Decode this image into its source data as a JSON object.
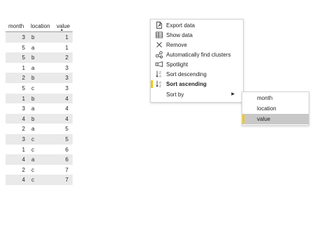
{
  "table": {
    "columns": [
      "month",
      "location",
      "value"
    ],
    "sort_indicator": "▲",
    "rows": [
      {
        "month": "3",
        "location": "b",
        "value": "1"
      },
      {
        "month": "5",
        "location": "a",
        "value": "1"
      },
      {
        "month": "5",
        "location": "b",
        "value": "2"
      },
      {
        "month": "1",
        "location": "a",
        "value": "3"
      },
      {
        "month": "2",
        "location": "b",
        "value": "3"
      },
      {
        "month": "5",
        "location": "c",
        "value": "3"
      },
      {
        "month": "1",
        "location": "b",
        "value": "4"
      },
      {
        "month": "3",
        "location": "a",
        "value": "4"
      },
      {
        "month": "4",
        "location": "b",
        "value": "4"
      },
      {
        "month": "2",
        "location": "a",
        "value": "5"
      },
      {
        "month": "3",
        "location": "c",
        "value": "5"
      },
      {
        "month": "1",
        "location": "c",
        "value": "6"
      },
      {
        "month": "4",
        "location": "a",
        "value": "6"
      },
      {
        "month": "2",
        "location": "c",
        "value": "7"
      },
      {
        "month": "4",
        "location": "c",
        "value": "7"
      }
    ]
  },
  "context_menu": {
    "items": [
      {
        "label": "Export data",
        "icon": "export-icon"
      },
      {
        "label": "Show data",
        "icon": "table-icon"
      },
      {
        "label": "Remove",
        "icon": "close-icon"
      },
      {
        "label": "Automatically find clusters",
        "icon": "clusters-icon"
      },
      {
        "label": "Spotlight",
        "icon": "spotlight-icon"
      },
      {
        "label": "Sort descending",
        "icon": "sort-descending-icon"
      },
      {
        "label": "Sort ascending",
        "icon": "sort-ascending-icon"
      },
      {
        "label": "Sort by",
        "icon": "",
        "submenu_arrow": "▶"
      }
    ]
  },
  "sort_by_submenu": {
    "items": [
      {
        "label": "month"
      },
      {
        "label": "location"
      },
      {
        "label": "value"
      }
    ],
    "selected": "value"
  },
  "colors": {
    "selection_accent": "#f2c811",
    "alt_row": "#eaeaea",
    "submenu_highlight": "#c8c8c8"
  }
}
